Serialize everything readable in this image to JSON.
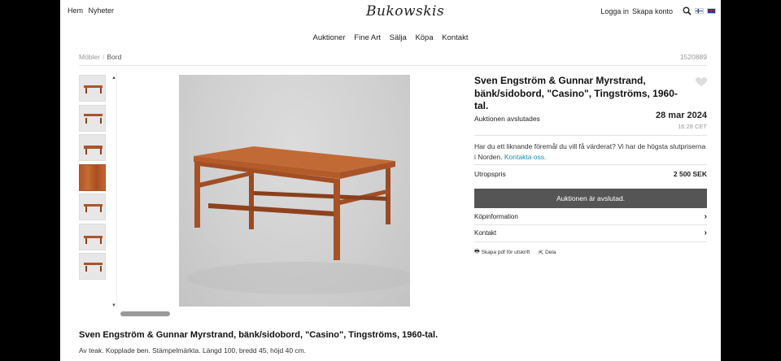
{
  "header": {
    "left_links": [
      "Hem",
      "Nyheter"
    ],
    "logo": "Bukowskis",
    "right_links": [
      "Logga in",
      "Skapa konto"
    ],
    "icons": [
      "search-icon",
      "flag-finland-icon",
      "flag-uk-icon"
    ]
  },
  "nav": {
    "items": [
      "Auktioner",
      "Fine Art",
      "Sälja",
      "Köpa",
      "Kontakt"
    ]
  },
  "breadcrumb": {
    "items": [
      "Möbler",
      "Bord"
    ],
    "separator": "/"
  },
  "lot_number": "1520889",
  "gallery": {
    "thumb_count": 7,
    "arrow_up": "▲",
    "arrow_down": "▼"
  },
  "lot": {
    "title": "Sven Engström & Gunnar Myrstrand, bänk/sidobord, \"Casino\", Tingströms, 1960-tal.",
    "status_label": "Auktionen avslutades",
    "end_date": "28 mar 2024",
    "end_time": "16:28 CET",
    "valuation_text": "Har du ett liknande föremål du vill få värderat? Vi har de högsta slutpriserna i Norden.",
    "valuation_link": "Kontakta oss.",
    "price_label": "Utropspris",
    "price_value": "2 500 SEK",
    "button_label": "Auktionen är avslutad.",
    "accordion": [
      "Köpinformation",
      "Kontakt"
    ],
    "actions": [
      "Skapa pdf för utskrift",
      "Dela"
    ]
  },
  "description": {
    "title": "Sven Engström & Gunnar Myrstrand, bänk/sidobord, \"Casino\", Tingströms, 1960-tal.",
    "text": "Av teak. Kopplade ben. Stämpelmärkta. Längd 100, bredd 45, höjd 40 cm."
  },
  "colors": {
    "accent_link": "#1a8fb0",
    "button_bg": "#555555",
    "teak": "#b5602c"
  }
}
